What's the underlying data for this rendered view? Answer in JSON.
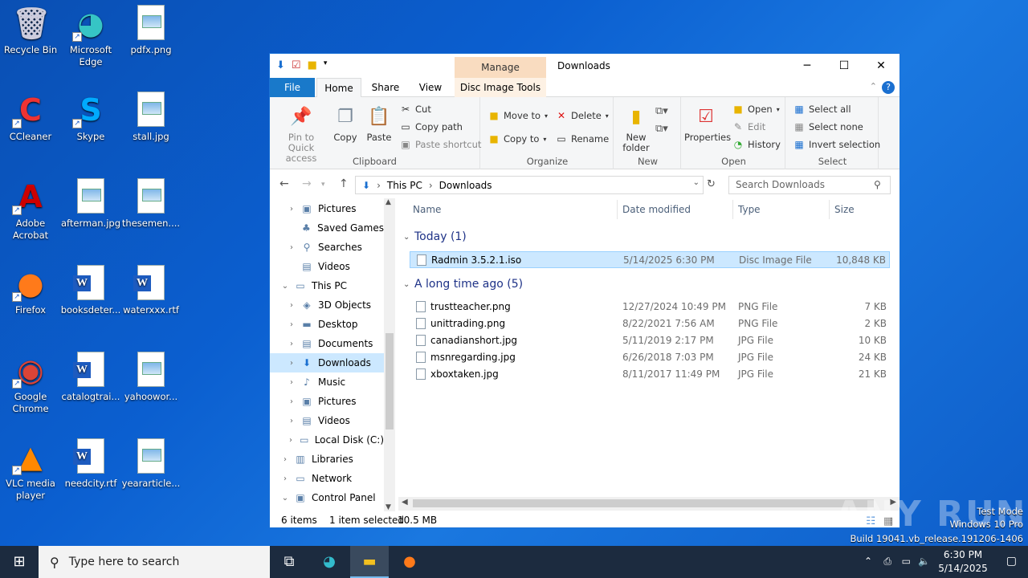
{
  "desktop": {
    "icons": [
      {
        "label": "Recycle Bin",
        "icon": "recycle-bin-icon"
      },
      {
        "label": "Microsoft Edge",
        "icon": "edge-icon"
      },
      {
        "label": "pdfx.png",
        "icon": "image-file-icon"
      },
      {
        "label": "CCleaner",
        "icon": "ccleaner-icon"
      },
      {
        "label": "Skype",
        "icon": "skype-icon"
      },
      {
        "label": "stall.jpg",
        "icon": "image-file-icon"
      },
      {
        "label": "Adobe Acrobat",
        "icon": "acrobat-icon"
      },
      {
        "label": "afterman.jpg",
        "icon": "image-file-icon"
      },
      {
        "label": "thesemen....",
        "icon": "image-file-icon"
      },
      {
        "label": "Firefox",
        "icon": "firefox-icon"
      },
      {
        "label": "booksdeter...",
        "icon": "word-file-icon"
      },
      {
        "label": "waterxxx.rtf",
        "icon": "word-file-icon"
      },
      {
        "label": "Google Chrome",
        "icon": "chrome-icon"
      },
      {
        "label": "catalogtrai...",
        "icon": "word-file-icon"
      },
      {
        "label": "yahoowor...",
        "icon": "image-file-icon"
      },
      {
        "label": "VLC media player",
        "icon": "vlc-icon"
      },
      {
        "label": "needcity.rtf",
        "icon": "word-file-icon"
      },
      {
        "label": "yeararticle...",
        "icon": "image-file-icon"
      }
    ]
  },
  "window": {
    "title": "Downloads",
    "context_tab": "Manage",
    "controls": {
      "minimize": "─",
      "maximize": "☐",
      "close": "✕"
    },
    "tabs": {
      "file": "File",
      "home": "Home",
      "share": "Share",
      "view": "View",
      "disc": "Disc Image Tools"
    },
    "ribbon": {
      "clipboard": {
        "label": "Clipboard",
        "pin": "Pin to Quick access",
        "copy": "Copy",
        "paste": "Paste",
        "cut": "Cut",
        "copy_path": "Copy path",
        "paste_shortcut": "Paste shortcut"
      },
      "organize": {
        "label": "Organize",
        "move_to": "Move to",
        "copy_to": "Copy to",
        "delete": "Delete",
        "rename": "Rename"
      },
      "new": {
        "label": "New",
        "new_folder": "New folder"
      },
      "open": {
        "label": "Open",
        "properties": "Properties",
        "open": "Open",
        "edit": "Edit",
        "history": "History"
      },
      "select": {
        "label": "Select",
        "select_all": "Select all",
        "select_none": "Select none",
        "invert": "Invert selection"
      }
    },
    "address": {
      "this_pc": "This PC",
      "downloads": "Downloads",
      "search_placeholder": "Search Downloads"
    },
    "nav": [
      {
        "label": "Pictures",
        "indent": 1,
        "chev": "›"
      },
      {
        "label": "Saved Games",
        "indent": 1,
        "chev": ""
      },
      {
        "label": "Searches",
        "indent": 1,
        "chev": "›"
      },
      {
        "label": "Videos",
        "indent": 1,
        "chev": ""
      },
      {
        "label": "This PC",
        "indent": 0,
        "chev": "⌄"
      },
      {
        "label": "3D Objects",
        "indent": 1,
        "chev": "›"
      },
      {
        "label": "Desktop",
        "indent": 1,
        "chev": "›"
      },
      {
        "label": "Documents",
        "indent": 1,
        "chev": "›"
      },
      {
        "label": "Downloads",
        "indent": 1,
        "chev": "›",
        "selected": true
      },
      {
        "label": "Music",
        "indent": 1,
        "chev": "›"
      },
      {
        "label": "Pictures",
        "indent": 1,
        "chev": "›"
      },
      {
        "label": "Videos",
        "indent": 1,
        "chev": "›"
      },
      {
        "label": "Local Disk (C:)",
        "indent": 1,
        "chev": "›"
      },
      {
        "label": "Libraries",
        "indent": 0,
        "chev": "›"
      },
      {
        "label": "Network",
        "indent": 0,
        "chev": "›"
      },
      {
        "label": "Control Panel",
        "indent": 0,
        "chev": "⌄"
      }
    ],
    "columns": {
      "name": "Name",
      "date": "Date modified",
      "type": "Type",
      "size": "Size"
    },
    "groups": [
      {
        "title": "Today (1)",
        "files": [
          {
            "name": "Radmin 3.5.2.1.iso",
            "date": "5/14/2025 6:30 PM",
            "type": "Disc Image File",
            "size": "10,848 KB",
            "selected": true
          }
        ]
      },
      {
        "title": "A long time ago (5)",
        "files": [
          {
            "name": "trustteacher.png",
            "date": "12/27/2024 10:49 PM",
            "type": "PNG File",
            "size": "7 KB"
          },
          {
            "name": "unittrading.png",
            "date": "8/22/2021 7:56 AM",
            "type": "PNG File",
            "size": "2 KB"
          },
          {
            "name": "canadianshort.jpg",
            "date": "5/11/2019 2:17 PM",
            "type": "JPG File",
            "size": "10 KB"
          },
          {
            "name": "msnregarding.jpg",
            "date": "6/26/2018 7:03 PM",
            "type": "JPG File",
            "size": "24 KB"
          },
          {
            "name": "xboxtaken.jpg",
            "date": "8/11/2017 11:49 PM",
            "type": "JPG File",
            "size": "21 KB"
          }
        ]
      }
    ],
    "status": {
      "items": "6 items",
      "selected": "1 item selected",
      "size": "10.5 MB"
    }
  },
  "taskbar": {
    "search_placeholder": "Type here to search",
    "time": "6:30 PM",
    "date": "5/14/2025"
  },
  "watermark": {
    "mode": "Test Mode",
    "edition": "Windows 10 Pro",
    "build": "Build 19041.vb_release.191206-1406",
    "brand": "ANY RUN"
  }
}
